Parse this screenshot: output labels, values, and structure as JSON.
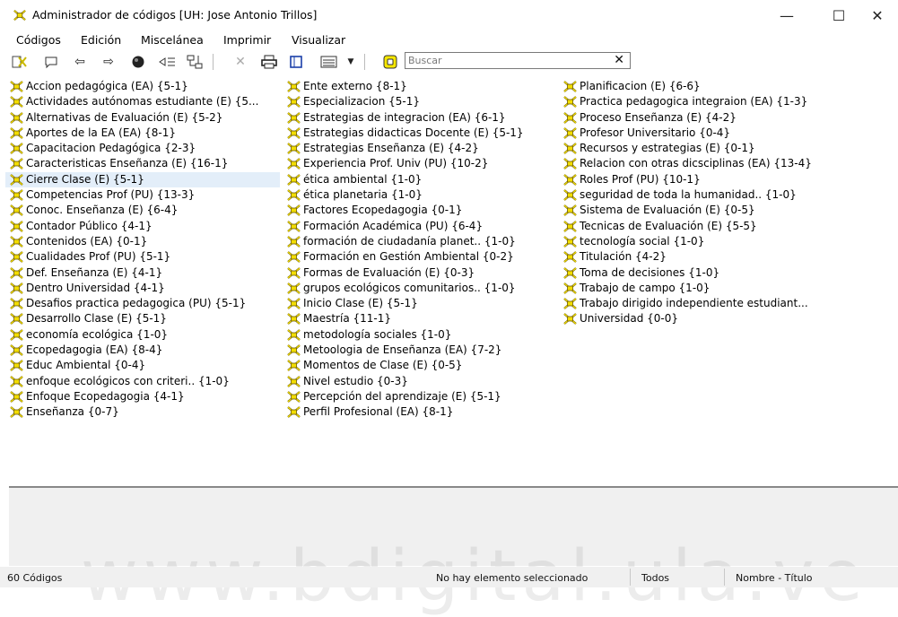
{
  "window": {
    "title": "Administrador de códigos [UH: Jose Antonio Trillos]",
    "minimize": "—",
    "maximize": "☐",
    "close": "✕"
  },
  "menu": [
    "Códigos",
    "Edición",
    "Miscelánea",
    "Imprimir",
    "Visualizar"
  ],
  "toolbar": {
    "search_placeholder": "Buscar",
    "clear_icon": "✕",
    "icons": [
      "new-code-icon",
      "comment-icon",
      "back-arrow-icon",
      "forward-arrow-icon",
      "record-icon",
      "filter-icon",
      "network-icon",
      "delete-icon",
      "print-icon",
      "view-single-icon",
      "view-list-icon",
      "dropdown-icon",
      "highlight-icon"
    ]
  },
  "codes": {
    "columns": [
      [
        "Accion pedagógica (EA) {5-1}",
        "Actividades autónomas estudiante (E) {5...",
        "Alternativas de Evaluación (E) {5-2}",
        "Aportes de la EA (EA) {8-1}",
        "Capacitacion Pedagógica {2-3}",
        "Caracteristicas Enseñanza (E) {16-1}",
        "Cierre Clase (E) {5-1}",
        "Competencias Prof (PU) {13-3}",
        "Conoc. Enseñanza (E) {6-4}",
        "Contador Público {4-1}",
        "Contenidos (EA) {0-1}",
        "Cualidades Prof (PU) {5-1}",
        "Def. Enseñanza (E) {4-1}",
        "Dentro Universidad {4-1}",
        "Desafios practica pedagogica (PU) {5-1}",
        "Desarrollo Clase (E) {5-1}",
        "economía ecológica {1-0}",
        "Ecopedagogia (EA) {8-4}",
        "Educ Ambiental {0-4}",
        "enfoque ecológicos con criteri.. {1-0}",
        "Enfoque Ecopedagogia {4-1}",
        "Enseñanza {0-7}"
      ],
      [
        "Ente externo {8-1}",
        "Especializacion {5-1}",
        "Estrategias de integracion (EA) {6-1}",
        "Estrategias didacticas Docente (E) {5-1}",
        "Estrategias Enseñanza (E) {4-2}",
        "Experiencia Prof. Univ (PU) {10-2}",
        "ética ambiental {1-0}",
        "ética planetaria {1-0}",
        "Factores Ecopedagogia {0-1}",
        "Formación Académica (PU) {6-4}",
        "formación de ciudadanía planet.. {1-0}",
        "Formación en Gestión Ambiental {0-2}",
        "Formas de Evaluación (E) {0-3}",
        "grupos ecológicos comunitarios.. {1-0}",
        "Inicio Clase (E) {5-1}",
        "Maestría {11-1}",
        "metodología sociales {1-0}",
        "Metoologia de Enseñanza (EA) {7-2}",
        "Momentos de Clase (E) {0-5}",
        "Nivel estudio {0-3}",
        "Percepción del aprendizaje (E) {5-1}",
        "Perfil Profesional (EA) {8-1}"
      ],
      [
        "Planificacion (E) {6-6}",
        "Practica pedagogica integraion (EA) {1-3}",
        "Proceso Enseñanza (E) {4-2}",
        "Profesor Universitario {0-4}",
        "Recursos y estrategias (E) {0-1}",
        "Relacion con otras dicsciplinas (EA) {13-4}",
        "Roles Prof (PU) {10-1}",
        "seguridad de toda la humanidad.. {1-0}",
        "Sistema de Evaluación (E) {0-5}",
        "Tecnicas de Evaluación (E) {5-5}",
        "tecnología social {1-0}",
        "Titulación {4-2}",
        "Toma de decisiones {1-0}",
        "Trabajo de campo {1-0}",
        "Trabajo dirigido independiente estudiant...",
        "Universidad {0-0}"
      ]
    ],
    "selected": "Cierre Clase (E) {5-1}"
  },
  "status": {
    "count": "60 Códigos",
    "selection": "No hay elemento seleccionado",
    "filter": "Todos",
    "sort": "Nombre - Título"
  },
  "watermark": "www.bdigital.ula.ve",
  "colors": {
    "code_icon": "#e8d400",
    "selected_row": "#e3eef9",
    "status_bg": "#f0f0f0"
  }
}
